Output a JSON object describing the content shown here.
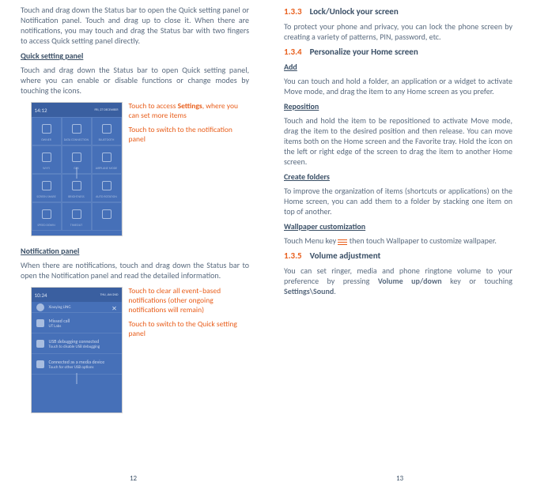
{
  "left": {
    "intro": "Touch and drag down the Status bar to open the Quick setting panel or Notification panel. Touch and drag up to close it. When there are notifications, you may touch and drag the Status bar with two fingers to access Quick setting panel directly.",
    "quickHeading": "Quick setting panel",
    "quickBody": "Touch and drag down the Status bar to open Quick setting panel, where you can enable or disable functions or change modes by touching the icons.",
    "quickCallout1a": "Touch to access ",
    "quickCallout1b": "Settings",
    "quickCallout1c": ", where you can set more items",
    "quickCallout2": "Touch to switch to the notification panel",
    "quickTime": "14:12",
    "quickDate": "FRI, 27 DECEMBER",
    "quickTiles": [
      "OWNER",
      "DATA CONNECTION",
      "BLUETOOTH",
      "WI-FI",
      "GPS",
      "AIRPLANE MODE",
      "SCREEN SHARE",
      "BRIGHTNESS",
      "AUTO ROTATION",
      "SPEED DOWN",
      "TIMEOUT",
      "",
      ""
    ],
    "notifHeading": "Notification panel",
    "notifBody": "When there are notifications, touch and drag down the Status bar to open the Notification panel and read the detailed information.",
    "notifCallout1": "Touch to clear all event–based notifications (other ongoing notifications will remain)",
    "notifCallout2": "Touch to switch to the Quick setting panel",
    "notifTime": "10:24",
    "notifDate": "THU, JAN 2ND",
    "notifDateSub": "Xiaoying LING",
    "notifRows": [
      {
        "t": "Missed call",
        "s": "UT Labs"
      },
      {
        "t": "USB debugging connected",
        "s": "Touch to disable USB debugging"
      },
      {
        "t": "Connected as a media device",
        "s": "Touch for other USB options"
      }
    ],
    "pageNum": "12"
  },
  "right": {
    "s133num": "1.3.3",
    "s133title": "Lock/Unlock your screen",
    "s133body": "To protect your phone and privacy, you can lock the phone screen by creating a variety of patterns, PIN, password, etc.",
    "s134num": "1.3.4",
    "s134title": "Personalize your Home screen",
    "addHead": "Add",
    "addBody": "You can touch and hold a folder, an application or a widget to activate Move mode, and drag the item to any Home screen as you prefer.",
    "repoHead": "Reposition",
    "repoBody": "Touch and hold the item to be repositioned to activate Move mode, drag the item to the desired position and then release. You can move items both on the Home screen and the Favorite tray. Hold the icon on the left or right edge of the screen to drag the item to another Home screen.",
    "foldHead": "Create folders",
    "foldBody": "To improve the organization of items (shortcuts or applications) on the Home screen, you can add them to a folder by stacking one item on top of another.",
    "wallHead": "Wallpaper customization",
    "wallBody1": "Touch Menu key ",
    "wallBody2": " then touch Wallpaper to customize wallpaper.",
    "s135num": "1.3.5",
    "s135title": "Volume adjustment",
    "s135a": "You can set ringer, media and phone ringtone volume to your preference by pressing ",
    "s135b": "Volume up/down",
    "s135c": " key or touching ",
    "s135d": "Settings\\Sound",
    "s135e": ".",
    "pageNum": "13"
  }
}
